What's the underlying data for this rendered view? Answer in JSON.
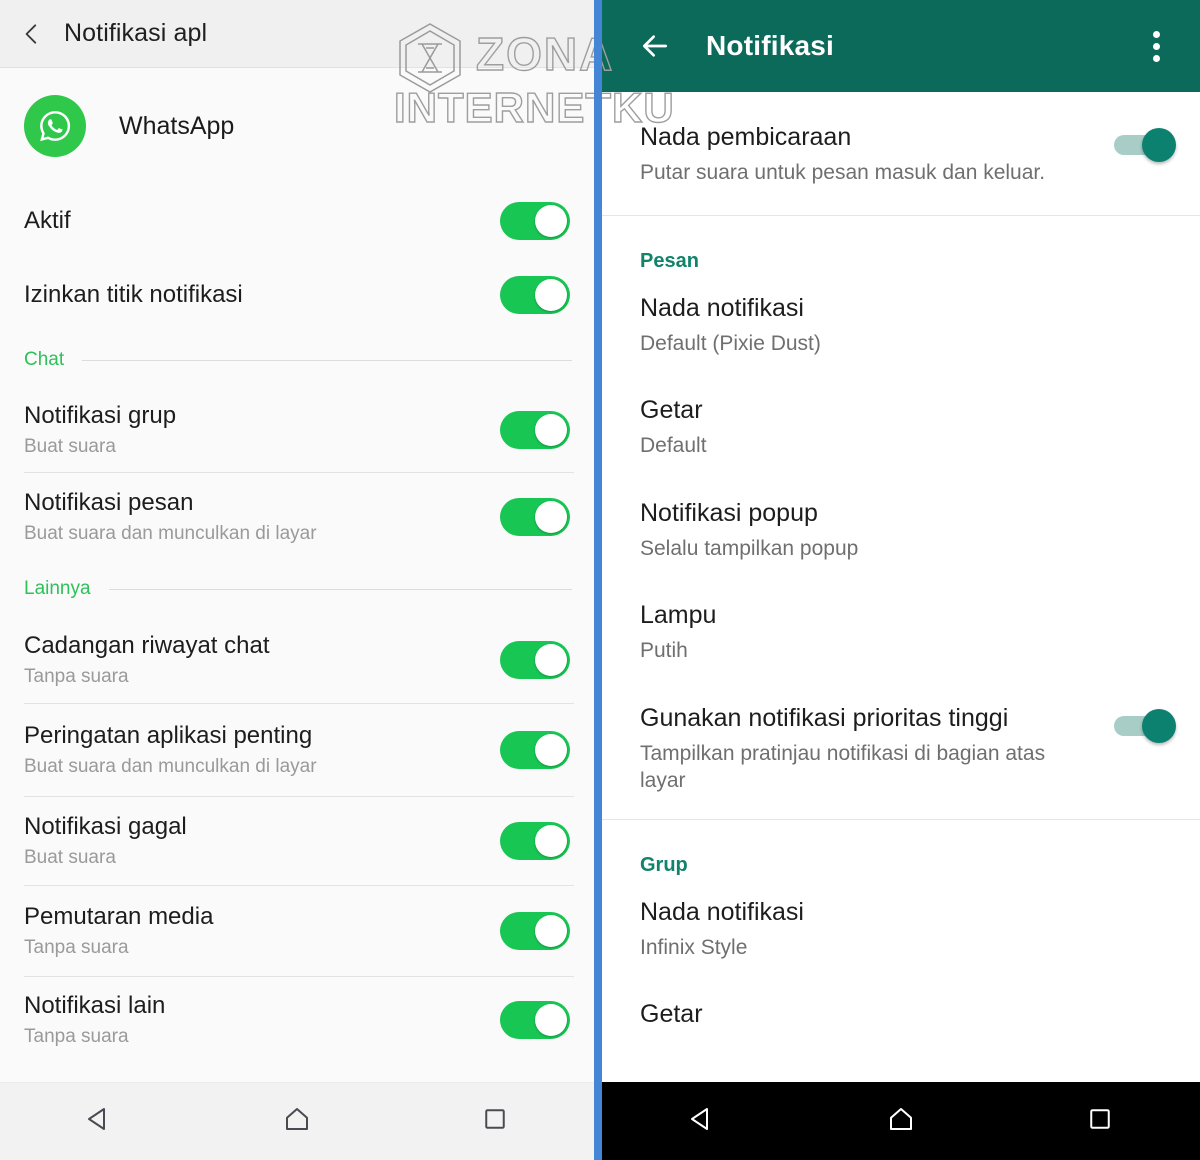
{
  "left": {
    "appbar": {
      "title": "Notifikasi apl",
      "back_icon": "chevron-left-icon"
    },
    "app": {
      "name": "WhatsApp",
      "icon": "whatsapp-icon"
    },
    "rows": [
      {
        "title": "Aktif",
        "sub": "",
        "toggle": true
      },
      {
        "title": "Izinkan titik notifikasi",
        "sub": "",
        "toggle": true
      }
    ],
    "sections": [
      {
        "label": "Chat",
        "rows": [
          {
            "title": "Notifikasi grup",
            "sub": "Buat suara",
            "toggle": true
          },
          {
            "title": "Notifikasi pesan",
            "sub": "Buat suara dan munculkan di layar",
            "toggle": true
          }
        ]
      },
      {
        "label": "Lainnya",
        "rows": [
          {
            "title": "Cadangan riwayat chat",
            "sub": "Tanpa suara",
            "toggle": true
          },
          {
            "title": "Peringatan aplikasi penting",
            "sub": "Buat suara dan munculkan di layar",
            "toggle": true
          },
          {
            "title": "Notifikasi gagal",
            "sub": "Buat suara",
            "toggle": true
          },
          {
            "title": "Pemutaran media",
            "sub": "Tanpa suara",
            "toggle": true
          },
          {
            "title": "Notifikasi lain",
            "sub": "Tanpa suara",
            "toggle": true
          }
        ]
      }
    ],
    "navbar": {
      "back_icon": "nav-back-triangle-icon",
      "home_icon": "nav-home-icon",
      "recents_icon": "nav-recents-square-icon"
    }
  },
  "right": {
    "appbar": {
      "title": "Notifikasi",
      "back_icon": "arrow-left-icon",
      "menu_icon": "overflow-menu-icon"
    },
    "top_row": {
      "title": "Nada pembicaraan",
      "sub": "Putar suara untuk pesan masuk dan keluar.",
      "toggle": true
    },
    "sections": [
      {
        "label": "Pesan",
        "rows": [
          {
            "title": "Nada notifikasi",
            "sub": "Default (Pixie Dust)",
            "toggle": false
          },
          {
            "title": "Getar",
            "sub": "Default",
            "toggle": false
          },
          {
            "title": "Notifikasi popup",
            "sub": "Selalu tampilkan popup",
            "toggle": false
          },
          {
            "title": "Lampu",
            "sub": "Putih",
            "toggle": false
          },
          {
            "title": "Gunakan notifikasi prioritas tinggi",
            "sub": "Tampilkan pratinjau notifikasi di bagian atas layar",
            "toggle": true
          }
        ]
      },
      {
        "label": "Grup",
        "rows": [
          {
            "title": "Nada notifikasi",
            "sub": "Infinix Style",
            "toggle": false
          },
          {
            "title": "Getar",
            "sub": "",
            "toggle": false
          }
        ]
      }
    ],
    "navbar": {
      "back_icon": "nav-back-triangle-icon",
      "home_icon": "nav-home-icon",
      "recents_icon": "nav-recents-square-icon"
    }
  },
  "watermark": {
    "line1": "ZONA",
    "line2": "INTERNETKU",
    "logo_icon": "hexagon-logo-icon"
  },
  "colors": {
    "left_toggle_green": "#17c653",
    "left_section_green": "#2ec05a",
    "right_header_teal": "#0c6a5b",
    "right_section_teal": "#11836c",
    "split_blue": "#4485d6"
  }
}
